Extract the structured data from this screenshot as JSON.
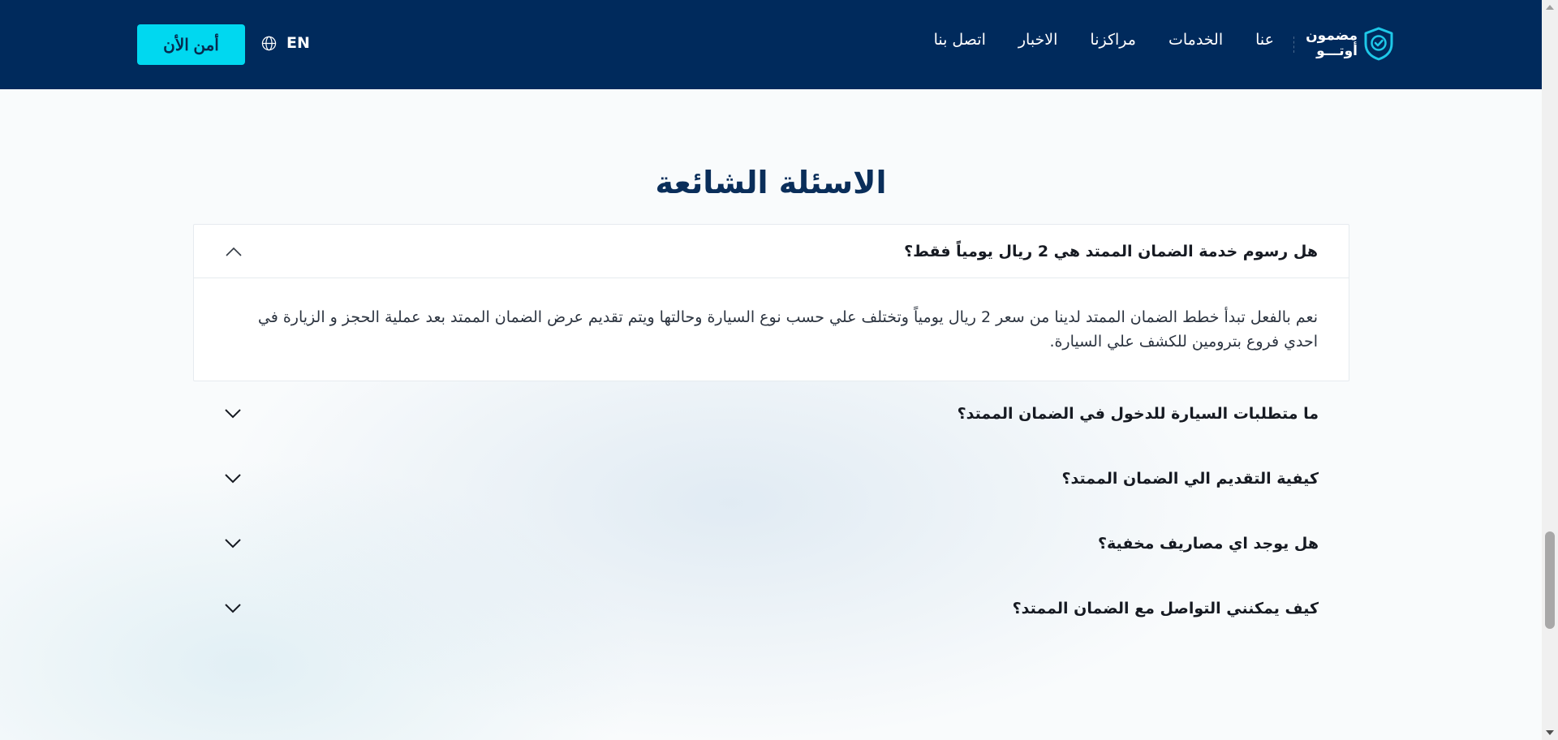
{
  "header": {
    "logo": {
      "line1": "مضمون",
      "line2": "أوتـــو",
      "icon": "shield-check-icon"
    },
    "nav": [
      {
        "label": "عنا"
      },
      {
        "label": "الخدمات"
      },
      {
        "label": "مراكزنا"
      },
      {
        "label": "الاخبار"
      },
      {
        "label": "اتصل بنا"
      }
    ],
    "language": {
      "label": "EN",
      "icon": "globe-icon"
    },
    "cta_label": "أمن الأن"
  },
  "faq": {
    "title": "الاسئلة الشائعة",
    "items": [
      {
        "question": "هل رسوم خدمة الضمان الممتد هي 2 ريال يومياً فقط؟",
        "answer": "نعم بالفعل تبدأ خطط الضمان الممتد لدينا من سعر 2 ريال يومياً وتختلف علي حسب نوع السيارة وحالتها ويتم تقديم عرض الضمان الممتد بعد عملية الحجز و الزيارة في احدي فروع بترومين للكشف علي السيارة.",
        "expanded": true
      },
      {
        "question": "ما متطلبات السيارة للدخول في الضمان الممتد؟",
        "expanded": false
      },
      {
        "question": "كيفية التقديم الي الضمان الممتد؟",
        "expanded": false
      },
      {
        "question": "هل يوجد اي مصاريف مخفية؟",
        "expanded": false
      },
      {
        "question": "كيف يمكنني التواصل مع الضمان الممتد؟",
        "expanded": false
      }
    ]
  },
  "colors": {
    "header_bg": "#002a5c",
    "accent": "#00d8f0",
    "title": "#0a2e5a"
  }
}
